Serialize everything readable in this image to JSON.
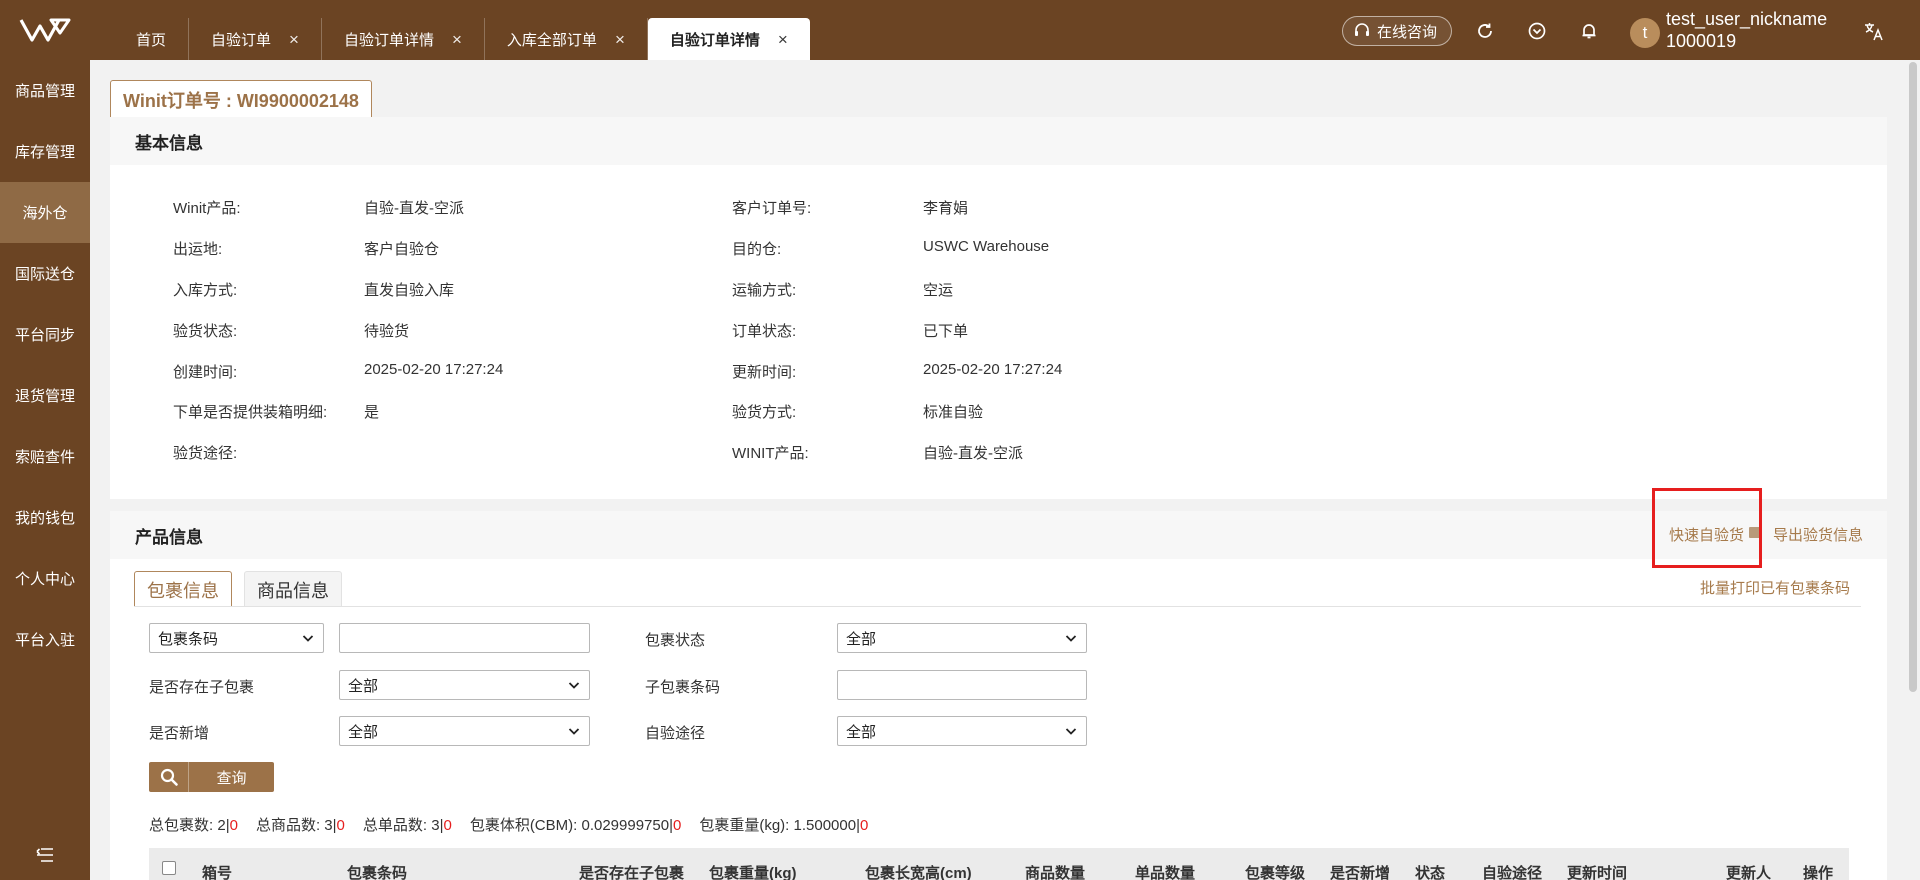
{
  "topbar": {
    "tabs": [
      {
        "label": "首页",
        "closable": false
      },
      {
        "label": "自验订单",
        "closable": true
      },
      {
        "label": "自验订单详情",
        "closable": true
      },
      {
        "label": "入库全部订单",
        "closable": true
      },
      {
        "label": "自验订单详情",
        "closable": true,
        "active": true
      }
    ],
    "close_glyph": "×",
    "consult_label": "在线咨询",
    "avatar_letter": "t",
    "user_name": "test_user_nickname",
    "user_id": "1000019",
    "icons": [
      "refresh-icon",
      "feedback-icon",
      "bell-icon",
      "translate-icon"
    ]
  },
  "sidebar": {
    "items": [
      {
        "label": "商品管理"
      },
      {
        "label": "库存管理"
      },
      {
        "label": "海外仓",
        "active": true
      },
      {
        "label": "国际送仓"
      },
      {
        "label": "平台同步"
      },
      {
        "label": "退货管理"
      },
      {
        "label": "索赔查件"
      },
      {
        "label": "我的钱包"
      },
      {
        "label": "个人中心"
      },
      {
        "label": "平台入驻"
      }
    ],
    "collapse_icon": "menu-collapse-icon"
  },
  "order_title": "Winit订单号 : WI9900002148",
  "basic": {
    "title": "基本信息",
    "left": [
      {
        "label": "Winit产品:",
        "value": "自验-直发-空派"
      },
      {
        "label": "出运地:",
        "value": "客户自验仓"
      },
      {
        "label": "入库方式:",
        "value": "直发自验入库"
      },
      {
        "label": "验货状态:",
        "value": "待验货"
      },
      {
        "label": "创建时间:",
        "value": "2025-02-20 17:27:24"
      },
      {
        "label": "下单是否提供装箱明细:",
        "value": "是"
      },
      {
        "label": "验货途径:",
        "value": ""
      }
    ],
    "right": [
      {
        "label": "客户订单号:",
        "value": "李育娟"
      },
      {
        "label": "目的仓:",
        "value": "USWC Warehouse"
      },
      {
        "label": "运输方式:",
        "value": "空运"
      },
      {
        "label": "订单状态:",
        "value": "已下单"
      },
      {
        "label": "更新时间:",
        "value": "2025-02-20 17:27:24"
      },
      {
        "label": "验货方式:",
        "value": "标准自验"
      },
      {
        "label": "WINIT产品:",
        "value": "自验-直发-空派"
      }
    ]
  },
  "product": {
    "title": "产品信息",
    "quick_inspect": "快速自验货",
    "export_inspect": "导出验货信息",
    "batch_print": "批量打印已有包裹条码",
    "subtabs": [
      "包裹信息",
      "商品信息"
    ]
  },
  "filters": {
    "barcode_type": "包裹条码",
    "barcode_value": "",
    "package_status_label": "包裹状态",
    "package_status_value": "全部",
    "has_child_label": "是否存在子包裹",
    "has_child_value": "全部",
    "child_barcode_label": "子包裹条码",
    "child_barcode_value": "",
    "is_new_label": "是否新增",
    "is_new_value": "全部",
    "route_label": "自验途径",
    "route_value": "全部",
    "query_label": "查询"
  },
  "summary": {
    "total_packages_label": "总包裹数:",
    "total_packages": "2",
    "total_packages_red": "0",
    "total_goods_label": "总商品数:",
    "total_goods": "3",
    "total_goods_red": "0",
    "total_sku_label": "总单品数:",
    "total_sku": "3",
    "total_sku_red": "0",
    "volume_label": "包裹体积(CBM):",
    "volume": "0.029999750",
    "volume_red": "0",
    "weight_label": "包裹重量(kg):",
    "weight": "1.500000",
    "weight_red": "0",
    "sep": "|"
  },
  "table": {
    "headers": [
      "箱号",
      "包裹条码",
      "是否存在子包裹",
      "包裹重量(kg)",
      "包裹长宽高(cm)",
      "商品数量",
      "单品数量",
      "包裹等级",
      "是否新增",
      "状态",
      "自验途径",
      "更新时间",
      "更新人",
      "操作"
    ]
  },
  "colors": {
    "brand": "#6b4423",
    "accent": "#9c7248",
    "highlight": "#e61e1e"
  }
}
